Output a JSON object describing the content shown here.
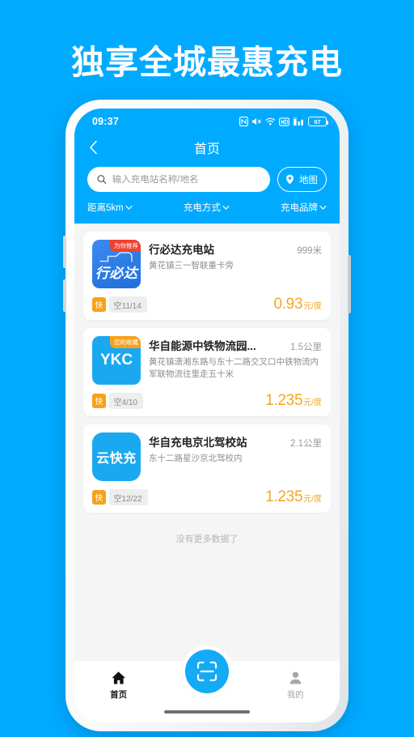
{
  "headline": "独享全城最惠充电",
  "colors": {
    "brand_blue": "#00AAFF",
    "fab_blue": "#14AAF5",
    "price_orange": "#f5a623",
    "badge_red": "#f0402f",
    "badge_orange": "#f6a21d"
  },
  "status_bar": {
    "time": "09:37",
    "battery_level": "97",
    "icons": [
      "nfc-icon",
      "mute-icon",
      "wifi-icon",
      "hd-icon",
      "signal-icon",
      "battery-icon"
    ]
  },
  "nav": {
    "back_icon": "back-chevron-icon",
    "title": "首页"
  },
  "search": {
    "placeholder": "输入充电站名称/地名",
    "value": "",
    "icon": "search-icon",
    "map_button_label": "地图",
    "map_button_icon": "location-pin-icon"
  },
  "filters": [
    {
      "label": "距离5km",
      "icon": "chevron-down-icon"
    },
    {
      "label": "充电方式",
      "icon": "chevron-down-icon"
    },
    {
      "label": "充电品牌",
      "icon": "chevron-down-icon"
    }
  ],
  "stations": [
    {
      "logo_text": "行必达",
      "logo_style": "truck-logo",
      "badge": "为你推荐",
      "badge_color": "red",
      "name": "行必达充电站",
      "distance": "999米",
      "address": "黄花镇三一智联重卡旁",
      "tag_type": "快",
      "slots": "空11/14",
      "price": "0.93",
      "price_unit": "元/度"
    },
    {
      "logo_text": "YKC",
      "logo_style": "ykc-logo",
      "badge": "您的收藏",
      "badge_color": "orange",
      "name": "华自能源中铁物流园...",
      "distance": "1.5公里",
      "address": "黄花镇潇湘东路与东十二路交叉口中铁物流内军联物流往里走五十米",
      "tag_type": "快",
      "slots": "空4/10",
      "price": "1.235",
      "price_unit": "元/度"
    },
    {
      "logo_text": "云快充",
      "logo_style": "ykc-rounded-logo",
      "badge": "",
      "badge_color": "",
      "name": "华自充电京北驾校站",
      "distance": "2.1公里",
      "address": "东十二路星沙京北驾校内",
      "tag_type": "快",
      "slots": "空12/22",
      "price": "1.235",
      "price_unit": "元/度"
    }
  ],
  "list_footer": "没有更多数据了",
  "tab_bar": {
    "home_label": "首页",
    "home_icon": "home-icon",
    "scan_icon": "scan-qr-icon",
    "profile_label": "我的",
    "profile_icon": "person-icon"
  }
}
